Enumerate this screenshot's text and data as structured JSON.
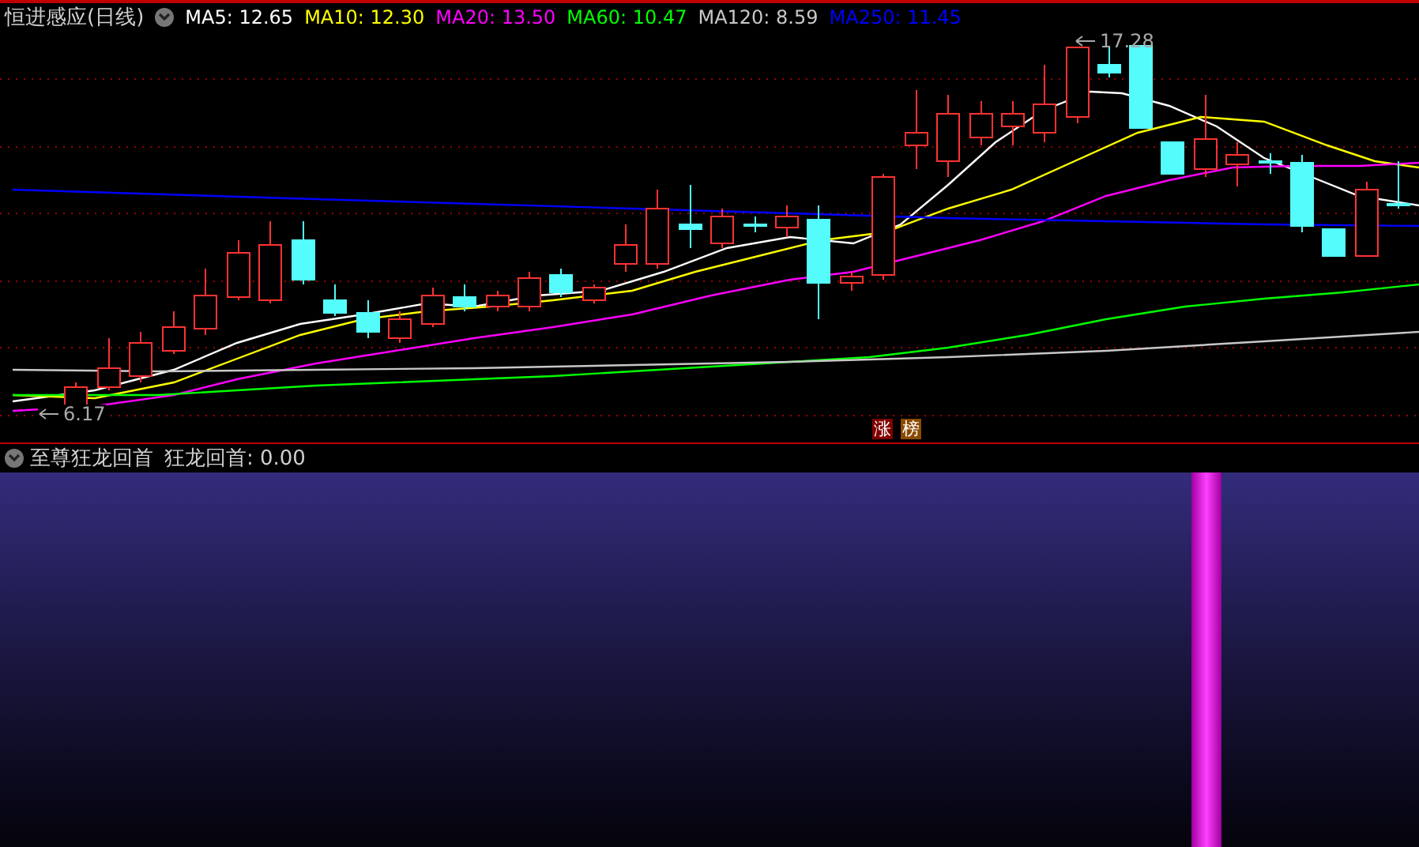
{
  "header": {
    "title": "恒进感应(日线)",
    "indicators": [
      {
        "label": "MA5: 12.65",
        "color": "#ffffff"
      },
      {
        "label": "MA10: 12.30",
        "color": "#ffff00"
      },
      {
        "label": "MA20: 13.50",
        "color": "#ff00ff"
      },
      {
        "label": "MA60: 10.47",
        "color": "#00ff00"
      },
      {
        "label": "MA120: 8.59",
        "color": "#c8c8c8"
      },
      {
        "label": "MA250: 11.45",
        "color": "#0000ff"
      }
    ]
  },
  "chart": {
    "high_label": "17.28",
    "low_label": "6.17"
  },
  "badges": [
    {
      "text": "涨",
      "color": "#800000"
    },
    {
      "text": "榜",
      "color": "#8b4a00"
    }
  ],
  "sub_panel": {
    "title": "至尊狂龙回首",
    "indicator": "狂龙回首: 0.00"
  }
}
